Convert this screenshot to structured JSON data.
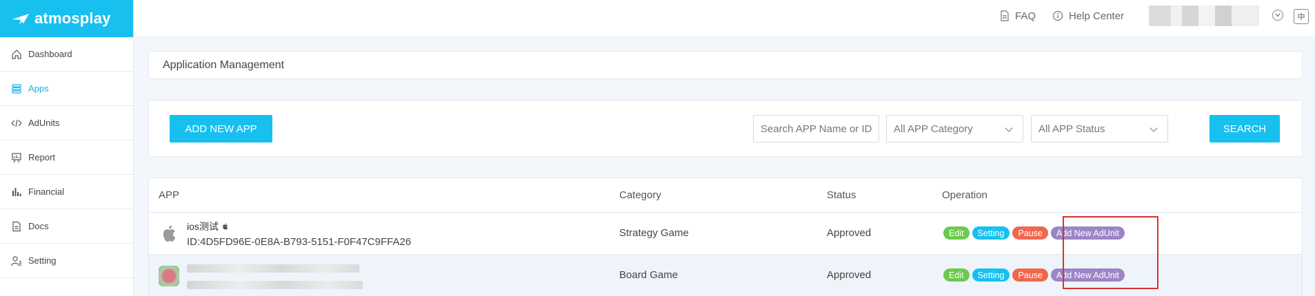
{
  "logo": {
    "text": "atmosplay"
  },
  "sidebar": {
    "items": [
      {
        "label": "Dashboard",
        "icon": "home-icon",
        "active": false
      },
      {
        "label": "Apps",
        "icon": "apps-icon",
        "active": true
      },
      {
        "label": "AdUnits",
        "icon": "code-icon",
        "active": false
      },
      {
        "label": "Report",
        "icon": "report-icon",
        "active": false
      },
      {
        "label": "Financial",
        "icon": "bar-chart-icon",
        "active": false
      },
      {
        "label": "Docs",
        "icon": "document-icon",
        "active": false
      },
      {
        "label": "Setting",
        "icon": "user-settings-icon",
        "active": false
      }
    ]
  },
  "topbar": {
    "faq": "FAQ",
    "help_center": "Help Center",
    "lang": "中"
  },
  "page": {
    "title": "Application Management"
  },
  "filters": {
    "add_button": "ADD NEW APP",
    "search_placeholder": "Search APP Name or ID",
    "category_select": "All APP Category",
    "status_select": "All APP Status",
    "search_button": "SEARCH"
  },
  "table": {
    "headers": {
      "app": "APP",
      "category": "Category",
      "status": "Status",
      "operation": "Operation"
    },
    "rows": [
      {
        "name": "ios测试",
        "id": "ID:4D5FD96E-0E8A-B793-5151-F0F47C9FFA26",
        "category": "Strategy Game",
        "status": "Approved"
      },
      {
        "name": "",
        "id": "",
        "category": "Board Game",
        "status": "Approved"
      }
    ],
    "operations": {
      "edit": "Edit",
      "setting": "Setting",
      "pause": "Pause",
      "add_adunit": "Add New AdUnit"
    }
  },
  "colors": {
    "brand": "#17c0ef",
    "edit": "#6cc94d",
    "pause": "#f0674d",
    "add_adunit": "#9c85c6",
    "highlight": "#d9302e"
  }
}
